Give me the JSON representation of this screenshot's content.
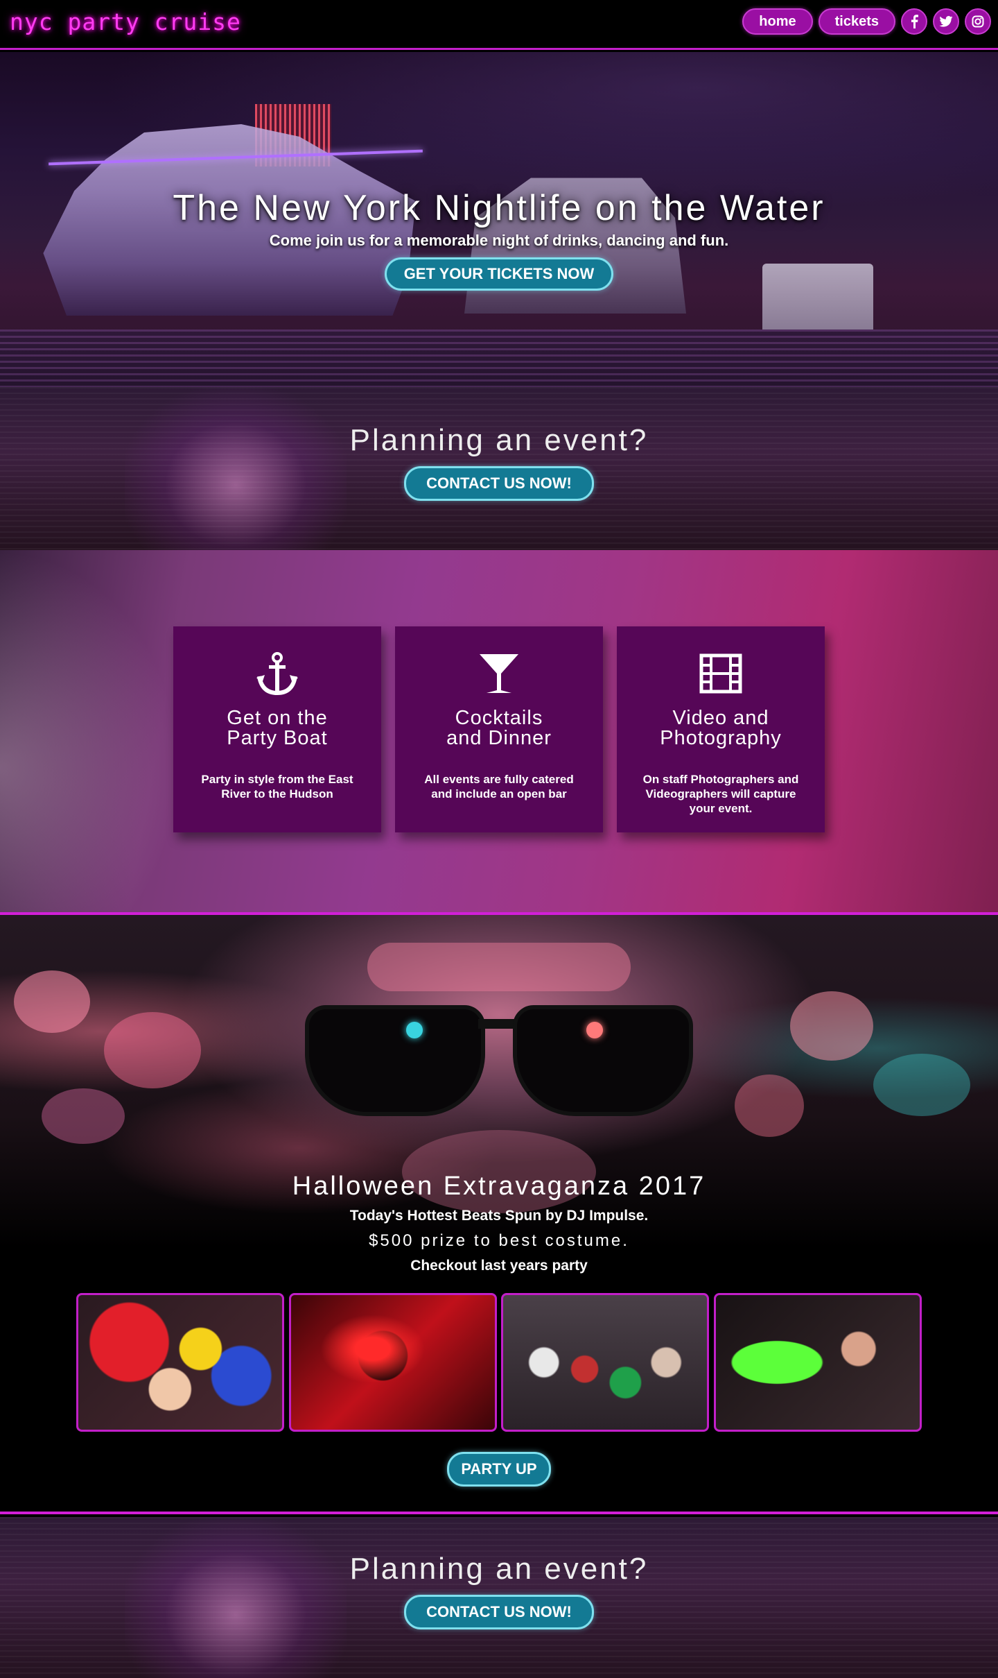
{
  "nav": {
    "brand": "nyc party cruise",
    "links": [
      {
        "label": "home"
      },
      {
        "label": "tickets"
      }
    ],
    "social": [
      {
        "icon": "facebook-icon",
        "glyph": "f"
      },
      {
        "icon": "twitter-icon",
        "glyph": "t"
      },
      {
        "icon": "instagram-icon",
        "glyph": "◎"
      }
    ]
  },
  "hero": {
    "title": "The New York Nightlife on the Water",
    "subtitle": "Come join us for a memorable night of drinks, dancing and fun.",
    "cta": "GET YOUR TICKETS NOW"
  },
  "planning": {
    "title": "Planning an event?",
    "cta": "CONTACT US NOW!"
  },
  "features": [
    {
      "icon": "anchor-icon",
      "title_line1": "Get on the",
      "title_line2": "Party Boat",
      "desc": "Party in style from the East River to the Hudson"
    },
    {
      "icon": "cocktail-icon",
      "title_line1": "Cocktails",
      "title_line2": "and Dinner",
      "desc": "All events are fully catered and include an open bar"
    },
    {
      "icon": "film-icon",
      "title_line1": "Video and",
      "title_line2": "Photography",
      "desc": "On staff Photographers and Videographers will capture your event."
    }
  ],
  "halloween": {
    "title": "Halloween Extravaganza 2017",
    "line1": "Today's Hottest Beats Spun by DJ Impulse.",
    "line2": "$500 prize to best costume.",
    "line3": "Checkout last years party",
    "cta": "PARTY UP"
  },
  "planning2": {
    "title": "Planning an event?",
    "cta": "CONTACT US NOW!"
  },
  "colors": {
    "accent": "#c21fc9",
    "nav_pill": "#9a0fa3",
    "button_teal": "#137a94",
    "card_bg": "#560657"
  }
}
